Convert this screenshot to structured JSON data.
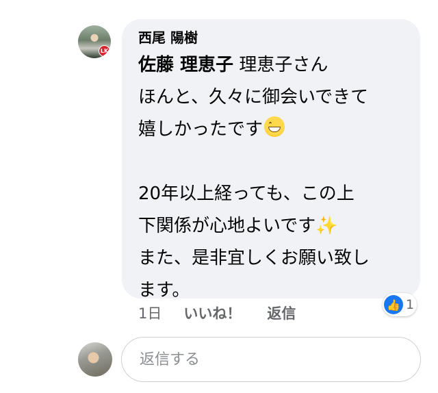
{
  "comment": {
    "author": "西尾 陽樹",
    "mention": "佐藤 理恵子",
    "text_after_mention": " 理恵子さん",
    "lines": [
      "ほんと、久々に御会いできて",
      "嬉しかったです",
      "",
      "20年以上経っても、この上",
      "下関係が心地よいです",
      "また、是非宜しくお願い致し",
      "ます。"
    ],
    "emoji_1": "grinning-face",
    "emoji_2": "sparkles"
  },
  "actions": {
    "time": "1日",
    "like_label": "いいね！",
    "reply_label": "返信"
  },
  "reaction": {
    "icon": "thumbs-up-icon",
    "count": "1",
    "color": "#1877f2"
  },
  "reply_input": {
    "placeholder": "返信する",
    "value": ""
  }
}
